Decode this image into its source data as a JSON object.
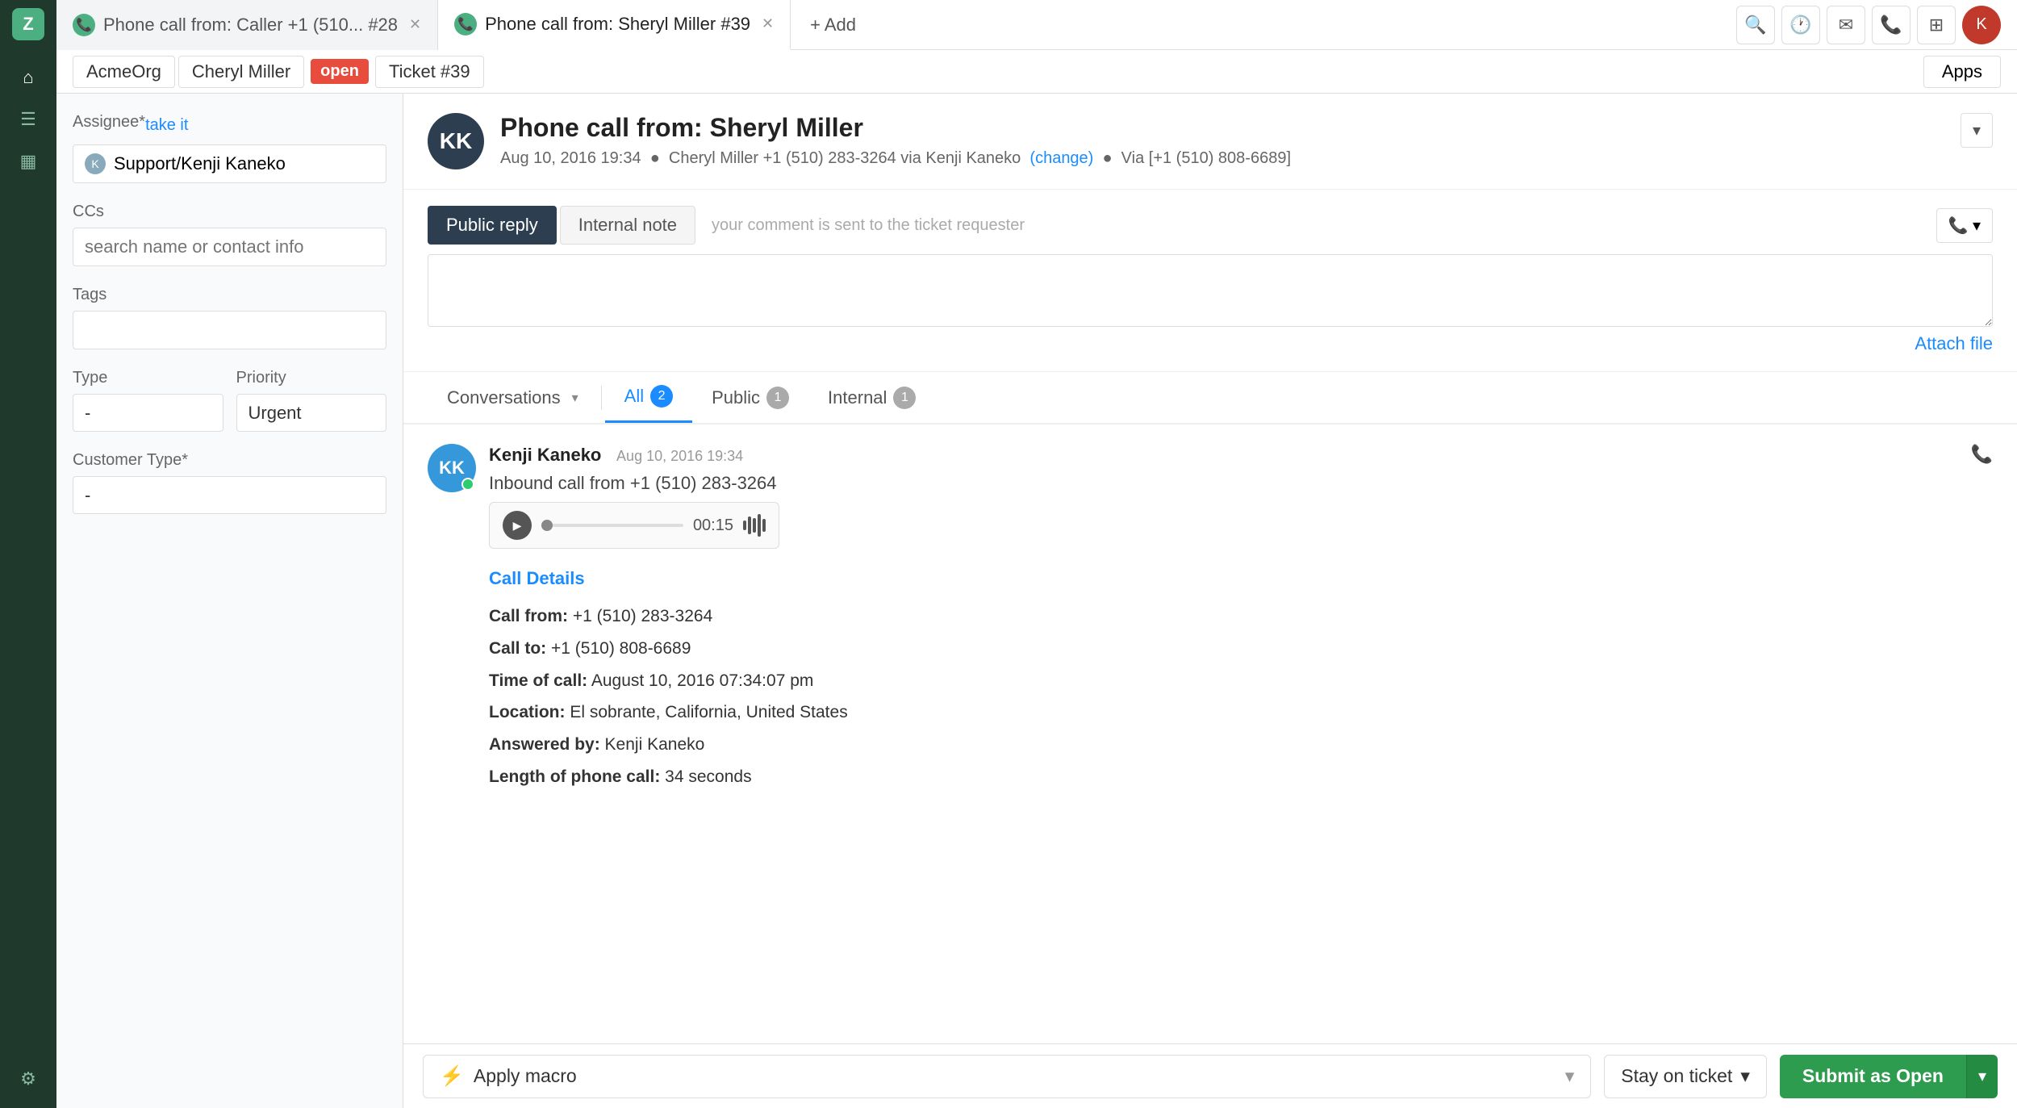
{
  "sidebar": {
    "logo_text": "Z",
    "icons": [
      {
        "name": "home-icon",
        "glyph": "⌂"
      },
      {
        "name": "tickets-icon",
        "glyph": "☰"
      },
      {
        "name": "reports-icon",
        "glyph": "▦"
      },
      {
        "name": "settings-icon",
        "glyph": "⚙"
      }
    ]
  },
  "topbar": {
    "tabs": [
      {
        "id": "tab1",
        "label": "Phone call from: Caller +1 (510... #28",
        "active": false
      },
      {
        "id": "tab2",
        "label": "Phone call from: Sheryl Miller #39",
        "active": true
      }
    ],
    "add_label": "+ Add",
    "apps_label": "Apps",
    "icons": [
      {
        "name": "search-icon",
        "glyph": "🔍"
      },
      {
        "name": "clock-icon",
        "glyph": "🕐"
      },
      {
        "name": "chat-icon",
        "glyph": "✉"
      },
      {
        "name": "phone-icon",
        "glyph": "📞"
      },
      {
        "name": "grid-icon",
        "glyph": "⊞"
      }
    ]
  },
  "breadcrumb": {
    "org": "AcmeOrg",
    "contact": "Cheryl Miller",
    "status": "open",
    "ticket": "Ticket #39",
    "apps_button": "Apps"
  },
  "left_panel": {
    "assignee_label": "Assignee*",
    "take_it_label": "take it",
    "assignee_value": "Support/Kenji Kaneko",
    "ccs_label": "CCs",
    "ccs_placeholder": "search name or contact info",
    "tags_label": "Tags",
    "tags_placeholder": "",
    "type_label": "Type",
    "type_value": "-",
    "priority_label": "Priority",
    "priority_value": "Urgent",
    "customer_type_label": "Customer Type*",
    "customer_type_value": "-"
  },
  "ticket": {
    "title": "Phone call from: Sheryl Miller",
    "meta_date": "Aug 10, 2016 19:34",
    "meta_caller": "Cheryl Miller +1 (510) 283-3264 via Kenji Kaneko",
    "meta_change": "(change)",
    "meta_via": "Via [+1 (510) 808-6689]",
    "dropdown_glyph": "▾"
  },
  "reply": {
    "public_reply_label": "Public reply",
    "internal_note_label": "Internal note",
    "hint": "your comment is sent to the ticket requester",
    "textarea_placeholder": "",
    "attach_file_label": "Attach file"
  },
  "conversations": {
    "tab_conversations_label": "Conversations",
    "tab_all_label": "All",
    "tab_all_count": "2",
    "tab_public_label": "Public",
    "tab_public_count": "1",
    "tab_internal_label": "Internal",
    "tab_internal_count": "1"
  },
  "message": {
    "author": "Kenji Kaneko",
    "time": "Aug 10, 2016 19:34",
    "text": "Inbound call from +1 (510) 283-3264",
    "audio_time": "00:15",
    "call_details_title": "Call Details",
    "call_from_label": "Call from:",
    "call_from_value": "+1 (510) 283-3264",
    "call_to_label": "Call to:",
    "call_to_value": "+1 (510) 808-6689",
    "time_of_call_label": "Time of call:",
    "time_of_call_value": "August 10, 2016 07:34:07 pm",
    "location_label": "Location:",
    "location_value": "El sobrante, California, United States",
    "answered_by_label": "Answered by:",
    "answered_by_value": "Kenji Kaneko",
    "length_label": "Length of phone call:",
    "length_value": "34 seconds"
  },
  "bottom_bar": {
    "macro_label": "Apply macro",
    "stay_on_ticket_label": "Stay on ticket",
    "submit_label": "Submit as Open"
  }
}
